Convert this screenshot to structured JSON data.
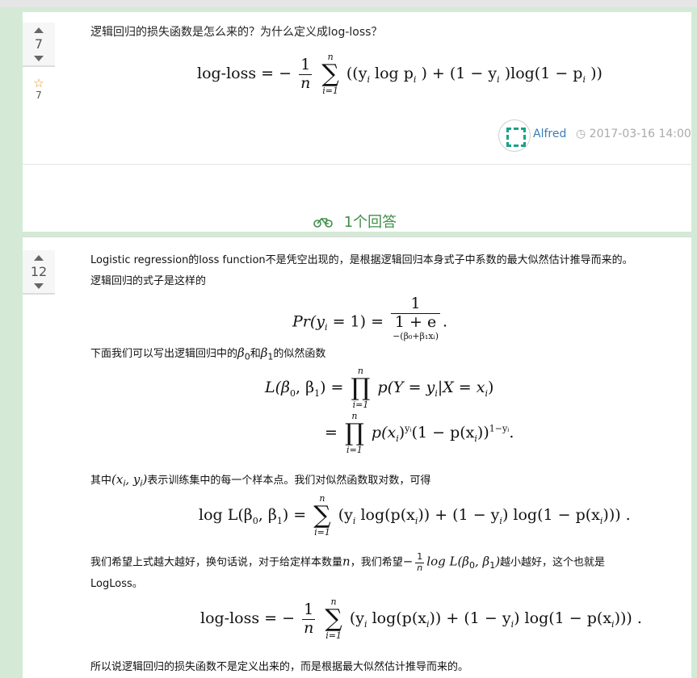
{
  "question": {
    "votes": "7",
    "favorites": "7",
    "title": "逻辑回归的损失函数是怎么来的？为什么定义成log-loss？",
    "formula": {
      "lhs": "log-loss",
      "eq": "=",
      "minus": "−",
      "num": "1",
      "den": "n",
      "sum_upper": "n",
      "sum_lower": "i=1",
      "body": "((y",
      "body2": "log p",
      "body3": ") + (1 − y",
      "body4": ")log(1 − p",
      "body5": "))",
      "sub_i": "i"
    },
    "author": "Alfred",
    "date": "2017-03-16 14:00"
  },
  "answers_header": "1个回答",
  "answer": {
    "votes": "12",
    "p1": "Logistic regression的loss function不是凭空出现的，是根据逻辑回归本身式子中系数的最大似然估计推导而来的。",
    "p2": "逻辑回归的式子是这样的",
    "f1_lhs": "Pr(y",
    "f1_lhs2": " = 1) =",
    "f1_num": "1",
    "f1_den": "1 + e",
    "f1_exp": "−(β₀+β₁xᵢ)",
    "f1_end": ".",
    "p3_a": "下面我们可以写出逻辑回归中的",
    "p3_b0": "β",
    "p3_sub0": "0",
    "p3_and": "和",
    "p3_b1": "β",
    "p3_sub1": "1",
    "p3_c": "的似然函数",
    "f2_lhs": "L(β",
    "f2_lhs_sub0": "0",
    "f2_lhs_mid": ", β",
    "f2_lhs_sub1": "1",
    "f2_lhs_end": ") =",
    "f2_prod_upper": "n",
    "f2_prod_lower": "i=1",
    "f2_line1": "p(Y = y",
    "f2_line1b": "|X = x",
    "f2_line1c": ")",
    "f2_eq2": "=",
    "f2_line2": "p(x",
    "f2_line2b": ")",
    "f2_line2_sup": "yᵢ",
    "f2_line2c": "(1 − p(x",
    "f2_line2d": "))",
    "f2_line2_sup2": "1−yᵢ",
    "f2_line2e": ".",
    "p4_a": "其中",
    "p4_m": "(x",
    "p4_m2": ", y",
    "p4_m3": ")",
    "p4_b": "表示训练集中的每一个样本点。我们对似然函数取对数，可得",
    "f3_lhs": "log L(β",
    "f3_lhs_mid": ", β",
    "f3_lhs_end": ") =",
    "f3_body": "(y",
    "f3_body2": "log(p(x",
    "f3_body3": ")) + (1 − y",
    "f3_body4": ") log(1 − p(x",
    "f3_body5": "))) .",
    "p5_a": "我们希望上式越大越好，换句话说，对于给定样本数量",
    "p5_n": "n",
    "p5_b": "，我们希望",
    "p5_m": "−",
    "p5_num": "1",
    "p5_den": "n",
    "p5_m2": "log L(β",
    "p5_m3": ", β",
    "p5_m4": ")",
    "p5_c": "越小越好，这个也就是",
    "p6": "LogLoss。",
    "f4_lhs": "log-loss =",
    "f4_minus": "−",
    "f4_num": "1",
    "f4_den": "n",
    "f4_body": "(y",
    "f4_body2": "log(p(x",
    "f4_body3": ")) + (1 − y",
    "f4_body4": ") log(1 − p(x",
    "f4_body5": "))) .",
    "p7": "所以说逻辑回归的损失函数不是定义出来的，而是根据最大似然估计推导而来的。"
  }
}
